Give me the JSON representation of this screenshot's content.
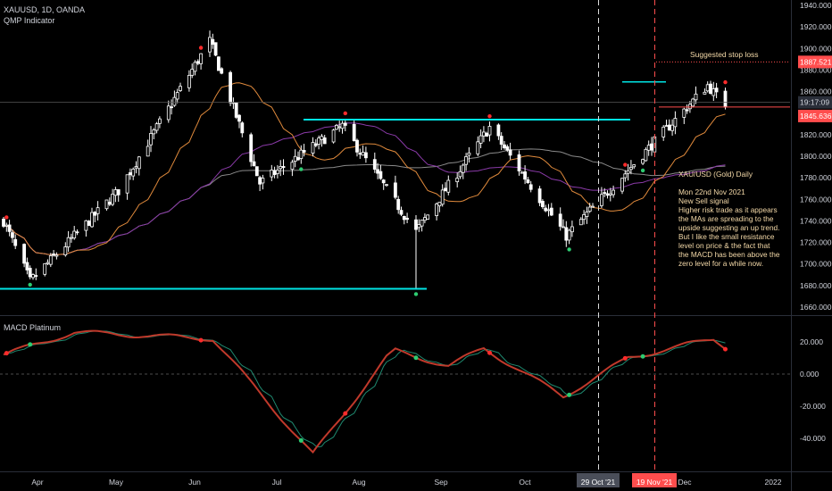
{
  "header": {
    "symbol_line": "XAUUSD, 1D, OANDA",
    "indicator_line": "QMP Indicator",
    "macd_title": "MACD Platinum"
  },
  "price_axis": {
    "ticks": [
      "1940.000",
      "1920.000",
      "1900.000",
      "1880.000",
      "1860.000",
      "1840.000",
      "1820.000",
      "1800.000",
      "1780.000",
      "1760.000",
      "1740.000",
      "1720.000",
      "1700.000",
      "1680.000",
      "1660.000"
    ],
    "tick_values": [
      1940,
      1920,
      1900,
      1880,
      1860,
      1840,
      1820,
      1800,
      1780,
      1760,
      1740,
      1720,
      1700,
      1680,
      1660
    ],
    "stop_loss_label": "1887.521",
    "countdown_label": "19:17:09",
    "last_price_label": "1845.636"
  },
  "macd_axis": {
    "ticks": [
      "20.000",
      "0.000",
      "-20.000",
      "-40.000"
    ],
    "tick_values": [
      20,
      0,
      -20,
      -40
    ]
  },
  "time_axis": {
    "labels": [
      "Apr",
      "May",
      "Jun",
      "Jul",
      "Aug",
      "Sep",
      "Oct",
      "Dec",
      "2022"
    ],
    "highlight_left": "29 Oct '21",
    "highlight_right": "19 Nov '21"
  },
  "annotations": {
    "stop_loss_text": "Suggested stop loss",
    "note_lines": [
      "XAU/USD (Gold) Daily",
      "",
      "Mon 22nd Nov 2021",
      "New Sell signal",
      "Higher risk trade as it appears",
      "the MAs are spreading to the",
      "upside suggesting an up trend.",
      "But I like the small resistance",
      "level on price & the fact that",
      "the MACD has been above the",
      "zero level for a while now."
    ]
  },
  "colors": {
    "up_candle": "#ffffff",
    "down_candle": "#ffffff",
    "support_line": "#00e5e5",
    "ma_orange": "#e08a3c",
    "ma_purple": "#8a3aa8",
    "ma_gray": "#8a8a8a",
    "macd_line": "#c0392b",
    "signal_line": "#1f8a70",
    "sell_dot": "#ff2b2b",
    "buy_dot": "#2ecc71",
    "stop_loss": "#ff4d4d",
    "note_text": "#f4d9a8"
  },
  "chart_data": {
    "type": "candlestick",
    "symbol": "XAUUSD",
    "timeframe": "1D",
    "ylim": [
      1650,
      1945
    ],
    "key_levels": {
      "support": 1677,
      "resistance": 1834,
      "stop_loss": 1887.521,
      "last_price": 1845.636
    },
    "ohlc_anchor_closes": [
      {
        "date": "2021-03-22",
        "close": 1740
      },
      {
        "date": "2021-03-31",
        "close": 1684
      },
      {
        "date": "2021-04-30",
        "close": 1768
      },
      {
        "date": "2021-05-31",
        "close": 1907
      },
      {
        "date": "2021-06-17",
        "close": 1775
      },
      {
        "date": "2021-07-15",
        "close": 1828
      },
      {
        "date": "2021-08-09",
        "close": 1730
      },
      {
        "date": "2021-09-03",
        "close": 1827
      },
      {
        "date": "2021-09-29",
        "close": 1726
      },
      {
        "date": "2021-10-22",
        "close": 1793
      },
      {
        "date": "2021-11-16",
        "close": 1866
      },
      {
        "date": "2021-11-22",
        "close": 1845.636
      }
    ],
    "macd": {
      "ylim": [
        -52,
        28
      ],
      "anchors": [
        {
          "date": "2021-03-22",
          "value": 12
        },
        {
          "date": "2021-04-15",
          "value": 26
        },
        {
          "date": "2021-06-01",
          "value": 22
        },
        {
          "date": "2021-07-05",
          "value": -50
        },
        {
          "date": "2021-08-01",
          "value": 15
        },
        {
          "date": "2021-08-20",
          "value": 5
        },
        {
          "date": "2021-09-01",
          "value": 16
        },
        {
          "date": "2021-09-28",
          "value": -14
        },
        {
          "date": "2021-10-20",
          "value": 10
        },
        {
          "date": "2021-11-18",
          "value": 22
        },
        {
          "date": "2021-11-22",
          "value": 17
        }
      ]
    },
    "signals": {
      "sell": [
        "2021-03-23",
        "2021-05-28",
        "2021-07-16",
        "2021-09-03",
        "2021-10-19",
        "2021-11-22"
      ],
      "buy": [
        "2021-03-31",
        "2021-07-01",
        "2021-08-09",
        "2021-09-30",
        "2021-10-25"
      ]
    }
  }
}
